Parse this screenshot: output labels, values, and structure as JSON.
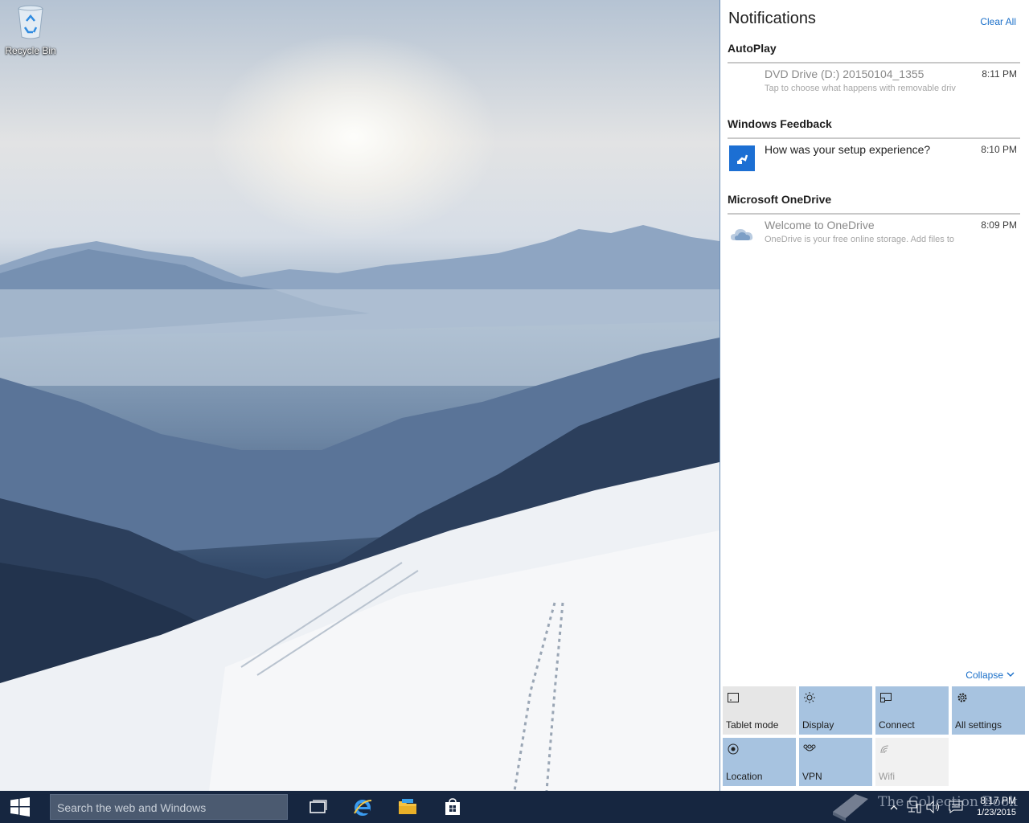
{
  "desktop": {
    "icons": [
      {
        "label": "Recycle Bin",
        "icon": "recycle-bin-icon"
      }
    ]
  },
  "action_center": {
    "title": "Notifications",
    "clear_all": "Clear All",
    "groups": [
      {
        "header": "AutoPlay",
        "notifications": [
          {
            "title": "DVD Drive (D:) 20150104_1355",
            "body": "Tap to choose what happens with removable driv",
            "time": "8:11 PM",
            "icon": "none",
            "dimmed": true
          }
        ]
      },
      {
        "header": "Windows Feedback",
        "notifications": [
          {
            "title": "How was your setup experience?",
            "body": "",
            "time": "8:10 PM",
            "icon": "feedback-icon",
            "dimmed": false
          }
        ]
      },
      {
        "header": "Microsoft OneDrive",
        "notifications": [
          {
            "title": "Welcome to OneDrive",
            "body": "OneDrive is your free online storage. Add files to",
            "time": "8:09 PM",
            "icon": "onedrive-cloud-icon",
            "dimmed": true
          }
        ]
      }
    ],
    "collapse": "Collapse",
    "quick_actions": [
      {
        "label": "Tablet mode",
        "icon": "tablet-mode-icon",
        "state": "off"
      },
      {
        "label": "Display",
        "icon": "brightness-icon",
        "state": "on"
      },
      {
        "label": "Connect",
        "icon": "connect-icon",
        "state": "on"
      },
      {
        "label": "All settings",
        "icon": "gear-icon",
        "state": "on"
      },
      {
        "label": "Location",
        "icon": "location-icon",
        "state": "on"
      },
      {
        "label": "VPN",
        "icon": "vpn-icon",
        "state": "on"
      },
      {
        "label": "Wifi",
        "icon": "wifi-icon",
        "state": "disabled"
      }
    ]
  },
  "taskbar": {
    "search_placeholder": "Search the web and Windows",
    "pinned": [
      {
        "name": "task-view",
        "icon": "task-view-icon"
      },
      {
        "name": "internet-explorer",
        "icon": "internet-explorer-icon"
      },
      {
        "name": "file-explorer",
        "icon": "folder-icon"
      },
      {
        "name": "store",
        "icon": "store-icon"
      }
    ],
    "tray_icons": [
      "chevron-up-icon",
      "network-icon",
      "volume-icon",
      "action-center-icon"
    ],
    "clock": {
      "time": "8:17 PM",
      "date": "1/23/2015"
    }
  },
  "watermark": {
    "text": "The Collection Book"
  },
  "colors": {
    "accent": "#1a6fc9",
    "tile_on": "#a7c3e0",
    "tile_off": "#e6e6e6",
    "taskbar": "#162640"
  }
}
